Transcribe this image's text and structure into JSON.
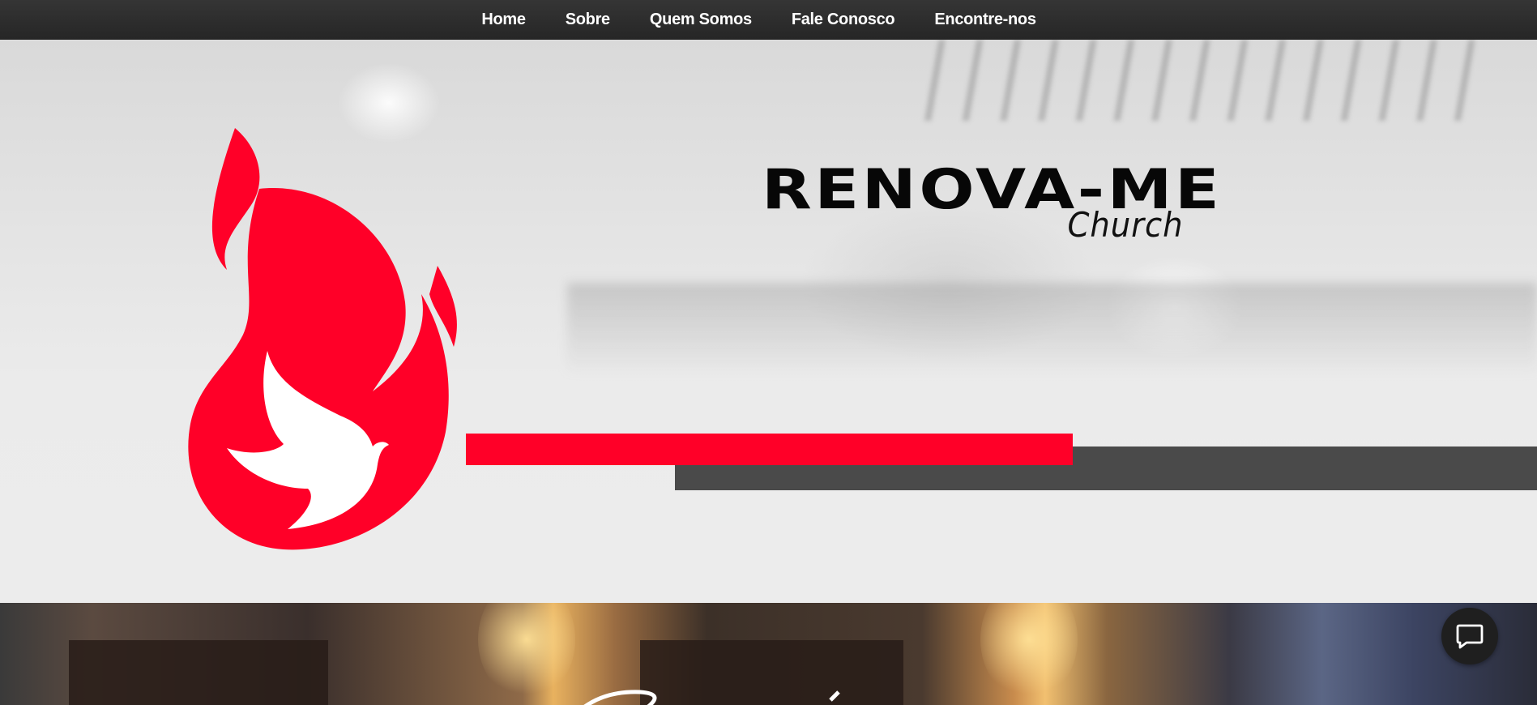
{
  "nav": {
    "items": [
      {
        "label": "Home"
      },
      {
        "label": "Sobre"
      },
      {
        "label": "Quem Somos"
      },
      {
        "label": "Fale Conosco"
      },
      {
        "label": "Encontre-nos"
      }
    ]
  },
  "hero": {
    "brand_title": "RENOVA-ME",
    "brand_subtitle": "Church",
    "colors": {
      "accent_red": "#ff0028",
      "dark_bar": "#4a4a4a",
      "nav_bg": "#2e2e2e"
    },
    "logo_icon": "flame-dove-icon"
  },
  "chat": {
    "icon": "chat-bubble-icon"
  }
}
